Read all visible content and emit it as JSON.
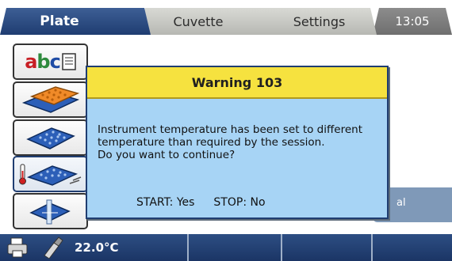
{
  "tabs": {
    "plate": "Plate",
    "cuvette": "Cuvette",
    "settings": "Settings",
    "clock": "13:05"
  },
  "sidebar": {
    "abc_button_text": "abc",
    "items": [
      {
        "name": "abc-icon"
      },
      {
        "name": "multi-plate-icon"
      },
      {
        "name": "microplate-icon"
      },
      {
        "name": "temperature-plate-icon"
      },
      {
        "name": "shake-plate-icon"
      }
    ]
  },
  "right_panel": {
    "text": "al"
  },
  "dialog": {
    "title": "Warning 103",
    "message_lines": [
      "Instrument temperature has been set to different",
      "temperature than required by the session.",
      "Do you want to continue?"
    ],
    "start_label": "START: Yes",
    "stop_label": "STOP: No"
  },
  "status": {
    "temperature": "22.0°C",
    "icons": [
      "printer-icon",
      "usb-stick-icon"
    ]
  },
  "colors": {
    "tab_active": "#2a4a80",
    "tab_inactive": "#c8c9c4",
    "dialog_title": "#f6e23f",
    "dialog_body": "#a7d4f5",
    "statusbar": "#234278"
  }
}
